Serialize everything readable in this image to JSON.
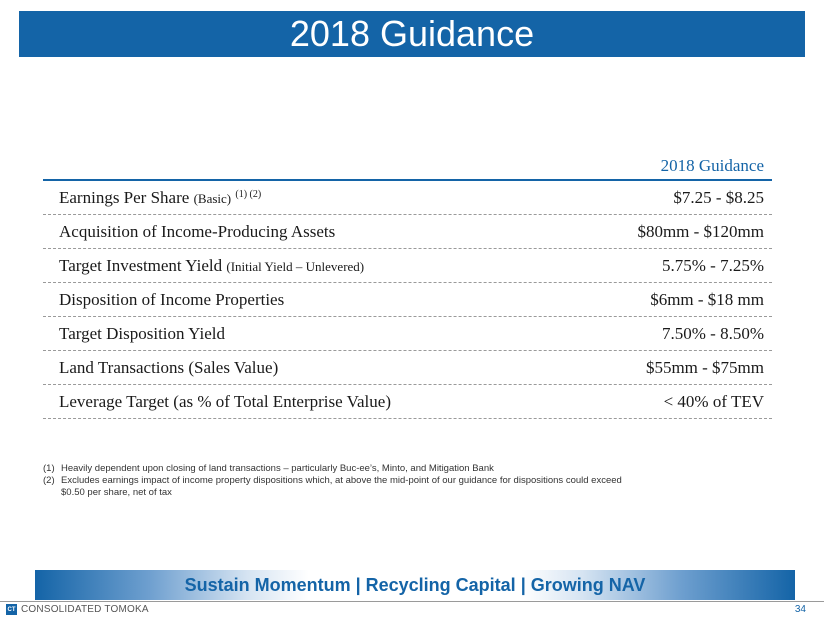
{
  "slide": {
    "title": "2018 Guidance",
    "column_header": "2018 Guidance",
    "rows": [
      {
        "label": "Earnings Per Share",
        "sub": "(Basic)",
        "sup": "(1) (2)",
        "value": "$7.25 - $8.25"
      },
      {
        "label": "Acquisition of Income-Producing Assets",
        "sub": "",
        "sup": "",
        "value": "$80mm - $120mm"
      },
      {
        "label": "Target Investment Yield",
        "sub": "(Initial Yield – Unlevered)",
        "sup": "",
        "value": "5.75% - 7.25%"
      },
      {
        "label": "Disposition of Income Properties",
        "sub": "",
        "sup": "",
        "value": "$6mm - $18 mm"
      },
      {
        "label": "Target Disposition Yield",
        "sub": "",
        "sup": "",
        "value": "7.50% - 8.50%"
      },
      {
        "label": "Land Transactions (Sales Value)",
        "sub": "",
        "sup": "",
        "value": "$55mm - $75mm"
      },
      {
        "label": "Leverage Target (as % of Total Enterprise Value)",
        "sub": "",
        "sup": "",
        "value": "< 40% of TEV"
      }
    ],
    "footnotes": [
      {
        "num": "(1)",
        "text": "Heavily dependent upon closing of land transactions – particularly Buc-ee’s, Minto, and Mitigation Bank"
      },
      {
        "num": "(2)",
        "text": "Excludes earnings impact of income property dispositions which, at above the mid-point of our guidance for dispositions could exceed $0.50 per share, net of tax"
      }
    ],
    "banner": "Sustain Momentum | Recycling Capital | Growing NAV",
    "company": "CONSOLIDATED TOMOKA",
    "logo_mark": "CT",
    "page_number": "34"
  },
  "colors": {
    "brand_blue": "#1464a7"
  }
}
